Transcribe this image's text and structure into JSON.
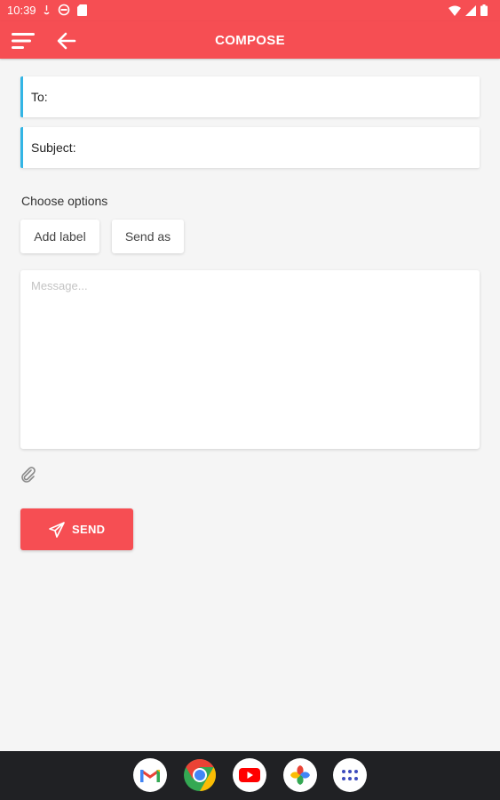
{
  "status_bar": {
    "time": "10:39",
    "left_icons": [
      "notification-icon",
      "vpn-icon",
      "sd-card-icon"
    ],
    "right_icons": [
      "wifi-icon",
      "signal-icon",
      "battery-icon"
    ]
  },
  "app_bar": {
    "title": "COMPOSE",
    "menu_icon": "hamburger-menu-icon",
    "back_icon": "back-arrow-icon",
    "color": "#f64e53"
  },
  "compose": {
    "to_label": "To:",
    "to_value": "",
    "subject_label": "Subject:",
    "subject_value": "",
    "options_label": "Choose options",
    "add_label_button": "Add label",
    "send_as_button": "Send as",
    "message_placeholder": "Message...",
    "message_value": "",
    "attach_icon": "paperclip-icon",
    "send_button": "SEND",
    "send_icon": "paper-plane-icon",
    "accent_color": "#33b5e5"
  },
  "dock": {
    "apps": [
      "gmail-icon",
      "chrome-icon",
      "youtube-icon",
      "photos-icon",
      "app-drawer-icon"
    ]
  }
}
